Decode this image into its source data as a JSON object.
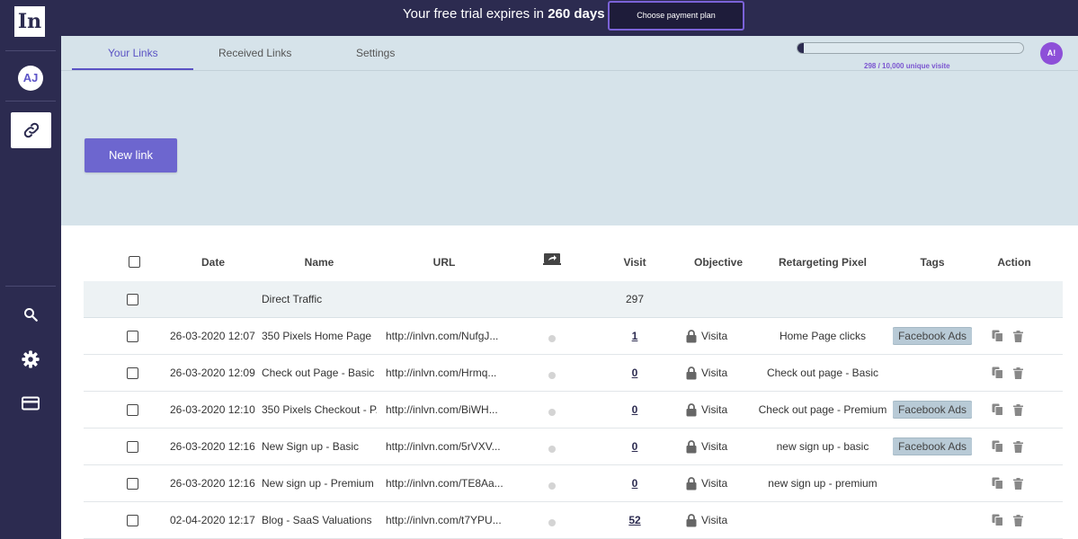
{
  "sidebar": {
    "logo": "In",
    "avatar_initials": "AJ",
    "icons": [
      "link-icon",
      "search-icon",
      "gear-icon",
      "credit-card-icon"
    ]
  },
  "banner": {
    "trial_prefix": "Your free trial expires in ",
    "trial_days": "260 days",
    "payment_button": "Choose payment plan"
  },
  "tabs": [
    {
      "label": "Your Links",
      "active": true
    },
    {
      "label": "Received Links",
      "active": false
    },
    {
      "label": "Settings",
      "active": false
    }
  ],
  "usage": {
    "text": "298 / 10,000 unique visite",
    "fraction": 0.0298
  },
  "user_avatar": "A!",
  "new_link_button": "New link",
  "table": {
    "headers": {
      "date": "Date",
      "name": "Name",
      "url": "URL",
      "preview_icon": "screen-share-icon",
      "visit": "Visit",
      "objective": "Objective",
      "pixel": "Retargeting Pixel",
      "tags": "Tags",
      "action": "Action"
    },
    "direct": {
      "name": "Direct Traffic",
      "visit": "297"
    },
    "rows": [
      {
        "date": "26-03-2020 12:07",
        "name": "350 Pixels Home Page",
        "url": "http://inlvn.com/NufgJ...",
        "visit": "1",
        "objective": "Visita",
        "pixel": "Home Page clicks",
        "tag": "Facebook Ads"
      },
      {
        "date": "26-03-2020 12:09",
        "name": "Check out Page - Basic",
        "url": "http://inlvn.com/Hrmq...",
        "visit": "0",
        "objective": "Visita",
        "pixel": "Check out page - Basic",
        "tag": ""
      },
      {
        "date": "26-03-2020 12:10",
        "name": "350 Pixels Checkout - P...",
        "url": "http://inlvn.com/BiWH...",
        "visit": "0",
        "objective": "Visita",
        "pixel": "Check out page - Premium",
        "tag": "Facebook Ads"
      },
      {
        "date": "26-03-2020 12:16",
        "name": "New Sign up - Basic",
        "url": "http://inlvn.com/5rVXV...",
        "visit": "0",
        "objective": "Visita",
        "pixel": "new sign up - basic",
        "tag": "Facebook Ads"
      },
      {
        "date": "26-03-2020 12:16",
        "name": "New sign up - Premium",
        "url": "http://inlvn.com/TE8Aa...",
        "visit": "0",
        "objective": "Visita",
        "pixel": "new sign up - premium",
        "tag": ""
      },
      {
        "date": "02-04-2020 12:17",
        "name": "Blog - SaaS Valuations",
        "url": "http://inlvn.com/t7YPU...",
        "visit": "52",
        "objective": "Visita",
        "pixel": "",
        "tag": ""
      }
    ]
  },
  "colors": {
    "sidebar": "#2c2b50",
    "accent": "#6d66cf",
    "header_bg": "#d6e3ea",
    "tag_bg": "#b8cad6"
  }
}
